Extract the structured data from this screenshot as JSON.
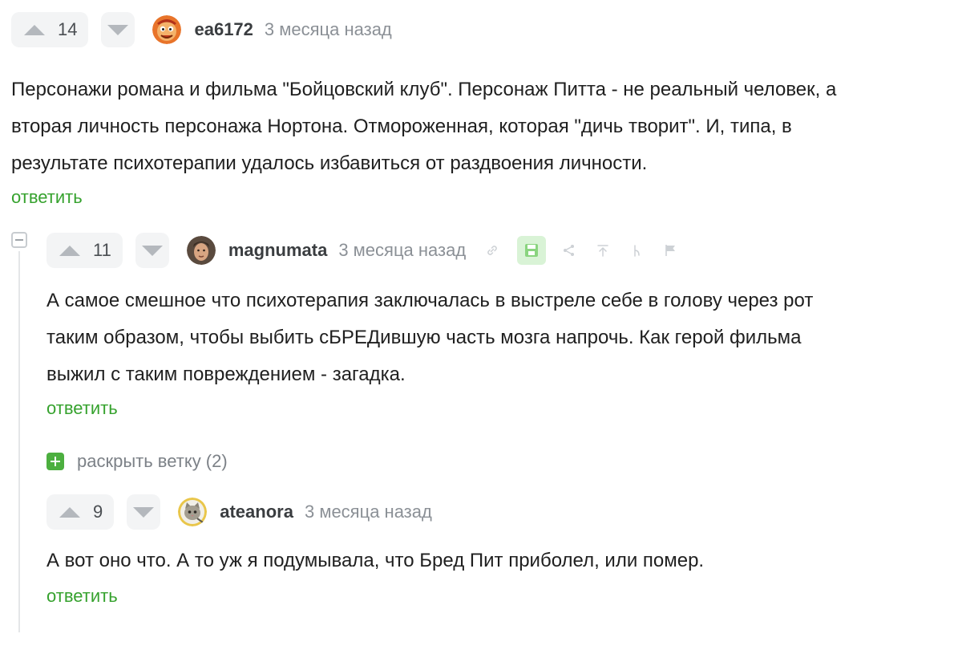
{
  "comments": [
    {
      "rating": "14",
      "username": "ea6172",
      "time": "3 месяца назад",
      "text_lines": [
        "Персонажи романа и фильма \"Бойцовский клуб\". Персонаж Питта - не реальный человек, а",
        "вторая личность персонажа Нортона. Отмороженная, которая \"дичь творит\". И, типа, в",
        "результате психотерапии удалось избавиться от раздвоения личности."
      ],
      "reply_label": "ответить",
      "avatar_icon": "cartoon-face-icon"
    },
    {
      "rating": "11",
      "username": "magnumata",
      "time": "3 месяца назад",
      "text_lines": [
        "А самое смешное что психотерапия заключалась в выстреле себе в голову через рот",
        "таким образом, чтобы выбить сБРЕДившую часть мозга напрочь. Как герой фильма",
        "выжил с таким повреждением - загадка."
      ],
      "reply_label": "ответить",
      "avatar_icon": "photo-avatar-icon",
      "tools": [
        "link-icon",
        "save-icon",
        "share-icon",
        "scroll-to-parent-icon",
        "branch-icon",
        "flag-icon"
      ]
    },
    {
      "rating": "9",
      "username": "ateanora",
      "time": "3 месяца назад",
      "text_lines": [
        "А вот оно что. А то уж я подумывала, что Бред Пит приболел, или помер."
      ],
      "reply_label": "ответить",
      "avatar_icon": "cat-avatar-icon"
    }
  ],
  "expand_thread": {
    "label": "раскрыть ветку (2)"
  },
  "colors": {
    "accent_green": "#36a22e",
    "vote_bg": "#f3f4f5",
    "muted_text": "#8b9096"
  }
}
